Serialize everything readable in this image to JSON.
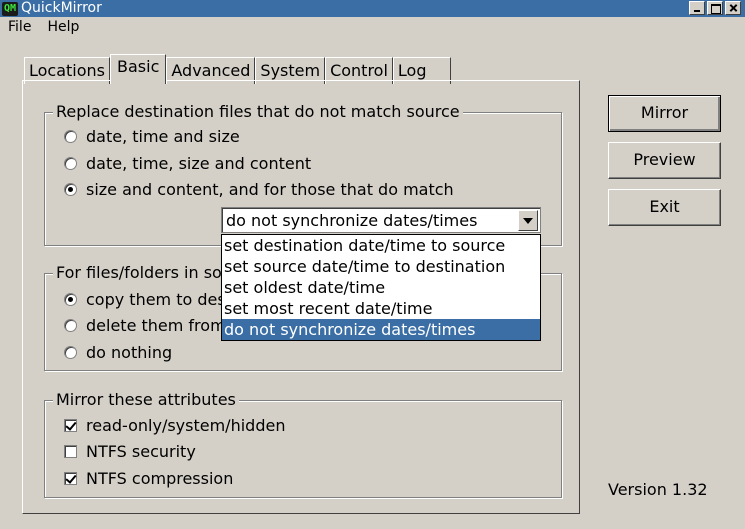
{
  "window": {
    "title": "QuickMirror",
    "icon_text": "QM"
  },
  "menu": {
    "file": "File",
    "help": "Help"
  },
  "tabs": [
    {
      "label": "Locations",
      "active": false
    },
    {
      "label": "Basic",
      "active": true
    },
    {
      "label": "Advanced",
      "active": false
    },
    {
      "label": "System",
      "active": false
    },
    {
      "label": "Control",
      "active": false
    },
    {
      "label": "Log",
      "active": false
    }
  ],
  "replace_group": {
    "title": "Replace destination files that do not match source",
    "options": [
      {
        "label": "date, time and size",
        "checked": false
      },
      {
        "label": "date, time, size and content",
        "checked": false
      },
      {
        "label": "size and content, and for those that do match",
        "checked": true
      }
    ],
    "combo_value": "do not synchronize dates/times",
    "dropdown_items": [
      "set destination date/time to source",
      "set source date/time to destination",
      "set oldest date/time",
      "set most recent date/time",
      "do not synchronize dates/times"
    ],
    "selected_index": 4
  },
  "files_group": {
    "title": "For files/folders in sou",
    "options": [
      {
        "label": "copy them to desti",
        "checked": true
      },
      {
        "label": "delete them from s",
        "checked": false
      },
      {
        "label": "do nothing",
        "checked": false
      }
    ]
  },
  "attributes_group": {
    "title": "Mirror these attributes",
    "options": [
      {
        "label": "read-only/system/hidden",
        "checked": true
      },
      {
        "label": "NTFS security",
        "checked": false
      },
      {
        "label": "NTFS compression",
        "checked": true
      }
    ]
  },
  "buttons": {
    "mirror": "Mirror",
    "preview": "Preview",
    "exit": "Exit"
  },
  "version": "Version 1.32",
  "colors": {
    "titlebar": "#3a6ea5",
    "face": "#d4d0c8",
    "selection": "#3a6ea5"
  }
}
